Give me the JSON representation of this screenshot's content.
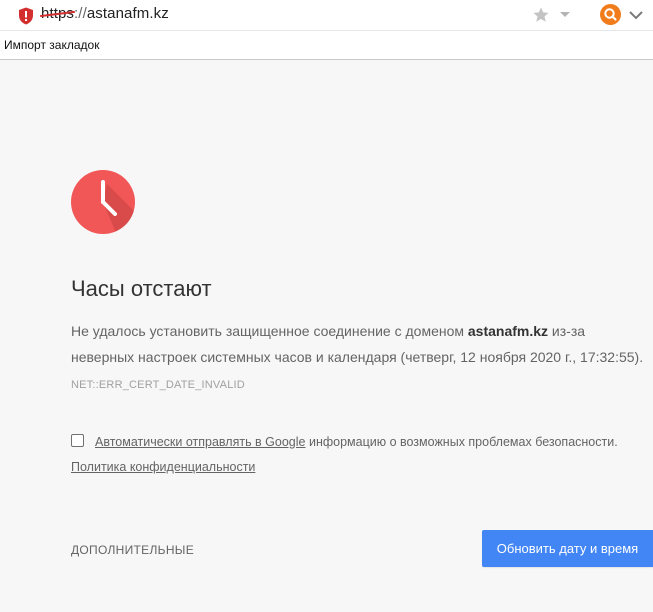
{
  "address_bar": {
    "url_scheme": "https",
    "url_separator": "://",
    "url_host": "astanafm.kz",
    "security_icon": "shield-exclamation-icon",
    "bookmark_icon": "star-icon",
    "search_engine_icon": "search-engine-icon",
    "menu_icon": "chevron-down-icon"
  },
  "bookmarks_bar": {
    "items": [
      {
        "label": "Импорт закладок"
      }
    ]
  },
  "interstitial": {
    "icon": "clock-icon",
    "icon_color": "#f25757",
    "title": "Часы отстают",
    "message_before_domain": "Не удалось установить защищенное соединение с доменом ",
    "domain": "astanafm.kz",
    "message_after_domain": " из-за неверных настроек системных часов и календаря (четверг, 12 ноября 2020 г., 17:32:55).",
    "error_code": "NET::ERR_CERT_DATE_INVALID",
    "opt_in_link": "Автоматически отправлять в Google",
    "opt_in_text": " информацию о возможных проблемах безопасности.",
    "opt_in_checked": false,
    "privacy_link": "Политика конфиденциальности",
    "details_button": "ДОПОЛНИТЕЛЬНЫЕ",
    "primary_button": "Обновить дату и время"
  },
  "colors": {
    "primary_button": "#4285f4",
    "url_strike": "#d32f2f",
    "shield": "#d32f2f",
    "search_engine": "#f07c1b"
  }
}
